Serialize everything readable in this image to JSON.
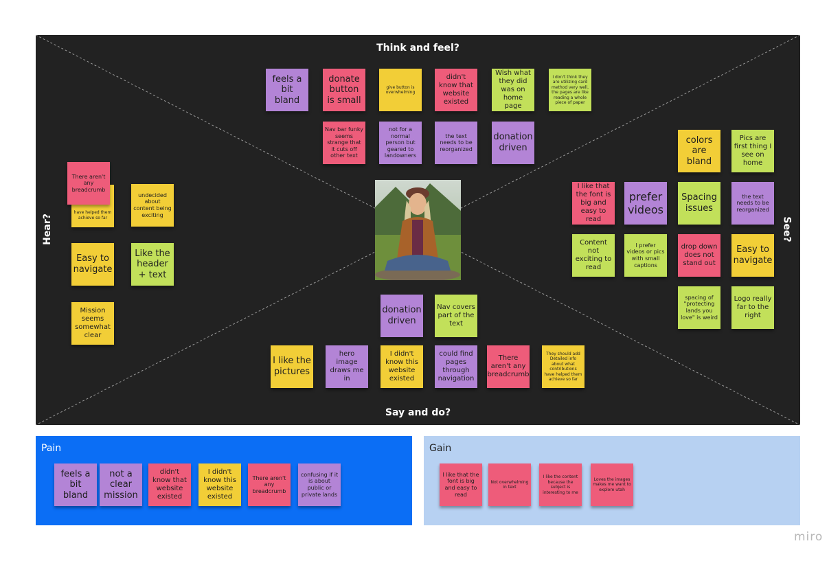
{
  "colors": {
    "board": "#222222",
    "purple": "#b384d6",
    "pink": "#ee5c7a",
    "yellow": "#f2ce37",
    "lime": "#c2e05a",
    "pain_bg": "#0b6ef5",
    "gain_bg": "#b7d1f2"
  },
  "quadrants": {
    "top": "Think and feel?",
    "bottom": "Say and do?",
    "left": "Hear?",
    "right": "See?"
  },
  "think": [
    "feels a bit bland",
    "donate button is small",
    "give button is overwhelming",
    "didn't know that website existed",
    "Wish what they did was on home page",
    "I don't think they are utilizing card method very well, the pages are like reading a whole piece of paper",
    "Nav bar  funky seems strange that it cuts off other text",
    "not for a normal person but geared to landowners",
    "the text needs to be reorganized",
    "donation driven"
  ],
  "hear": [
    "have helped them achieve so far",
    "There aren't any breadcrumb",
    "undecided about content being exciting",
    "Easy to navigate",
    "Like the header + text",
    "Mission seems somewhat clear"
  ],
  "see": [
    "colors are bland",
    "Pics are first thing I see on home",
    "I like that the font is big and easy to read",
    "prefer videos",
    "Spacing issues",
    "the text needs to be reorganized",
    "Content not exciting to read",
    "I prefer videos or pics with small captions",
    "drop down does not stand out",
    "Easy to navigate",
    "spacing of \"protecting lands you love\" is weird",
    "Logo really far to the right"
  ],
  "say": [
    "donation driven",
    "Nav covers part of the text",
    "I like the pictures",
    "hero image draws me in",
    "I didn't know this website existed",
    "could find pages through navigation",
    "There aren't any breadcrumb",
    "They should add Detailed info about what contributions have helped them achieve so far"
  ],
  "pain": {
    "title": "Pain",
    "notes": [
      "feels a bit bland",
      "not a clear mission",
      "didn't know that website existed",
      "I didn't know this website existed",
      "There aren't any breadcrumb",
      "confusing if it is about public or private lands"
    ]
  },
  "gain": {
    "title": "Gain",
    "notes": [
      "I like that the font is big and easy to read",
      "Not overwhelming in text",
      "I like the content because the subject is interesting to me",
      "Loves the images makes me want to explore utah"
    ]
  },
  "brand": "miro"
}
